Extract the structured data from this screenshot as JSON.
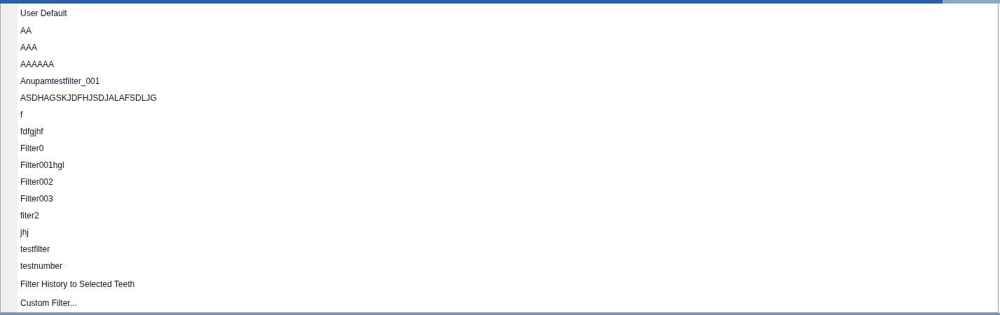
{
  "menu": {
    "items": [
      {
        "label": "User Default",
        "kind": "default"
      },
      {
        "label": "AA",
        "kind": "saved"
      },
      {
        "label": "AAA",
        "kind": "saved"
      },
      {
        "label": "AAAAAA",
        "kind": "saved"
      },
      {
        "label": "Anupamtestfilter_001",
        "kind": "saved"
      },
      {
        "label": "ASDHAGSKJDFHJSDJALAFSDLJG",
        "kind": "saved"
      },
      {
        "label": "f",
        "kind": "saved"
      },
      {
        "label": "fdfgjhf",
        "kind": "saved"
      },
      {
        "label": "Filter0",
        "kind": "saved"
      },
      {
        "label": "Filter001hgl",
        "kind": "saved"
      },
      {
        "label": "Filter002",
        "kind": "saved"
      },
      {
        "label": "Filter003",
        "kind": "saved"
      },
      {
        "label": "fiter2",
        "kind": "saved"
      },
      {
        "label": "jhj",
        "kind": "saved"
      },
      {
        "label": "testfilter",
        "kind": "saved"
      },
      {
        "label": "testnumber",
        "kind": "saved"
      },
      {
        "label": "Filter History to Selected Teeth",
        "kind": "command"
      },
      {
        "label": "Custom Filter...",
        "kind": "command"
      }
    ]
  }
}
